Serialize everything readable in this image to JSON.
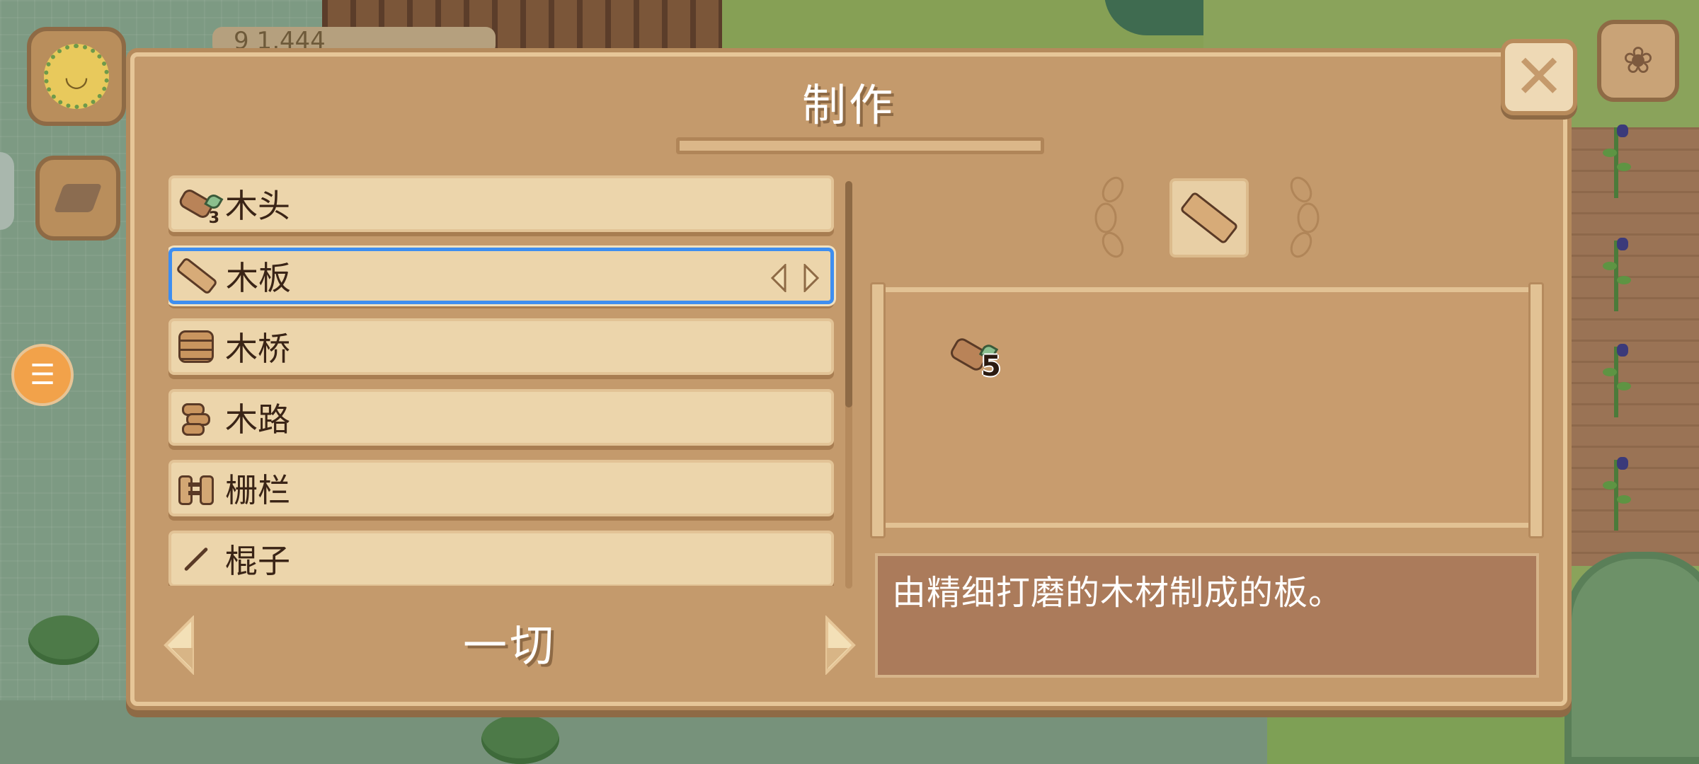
{
  "panel": {
    "title": "制作",
    "close_icon": "close-icon"
  },
  "recipes": [
    {
      "label": "木头",
      "icon": "log-icon",
      "qty": "3"
    },
    {
      "label": "木板",
      "icon": "plank-icon",
      "selected": true
    },
    {
      "label": "木桥",
      "icon": "bridge-icon"
    },
    {
      "label": "木路",
      "icon": "path-icon"
    },
    {
      "label": "栅栏",
      "icon": "fence-icon"
    },
    {
      "label": "棍子",
      "icon": "stick-icon"
    }
  ],
  "category": {
    "label": "一切"
  },
  "detail": {
    "preview_icon": "plank-icon",
    "ingredients": [
      {
        "icon": "log-icon",
        "count": "5"
      }
    ],
    "description": "由精细打磨的木材制成的板。"
  },
  "hud": {
    "money": "9   1,444",
    "avatar_icon": "sunflower-avatar-icon",
    "tool_icon": "axe-icon",
    "menu_icon": "list-icon",
    "pet_icon": "paw-icon"
  },
  "colors": {
    "panel": "#c49a6c",
    "item_bg": "#ecd5ab",
    "selected_border": "#3e8ef0",
    "description_bg": "#ab7b5b",
    "fab": "#f2a24a"
  }
}
